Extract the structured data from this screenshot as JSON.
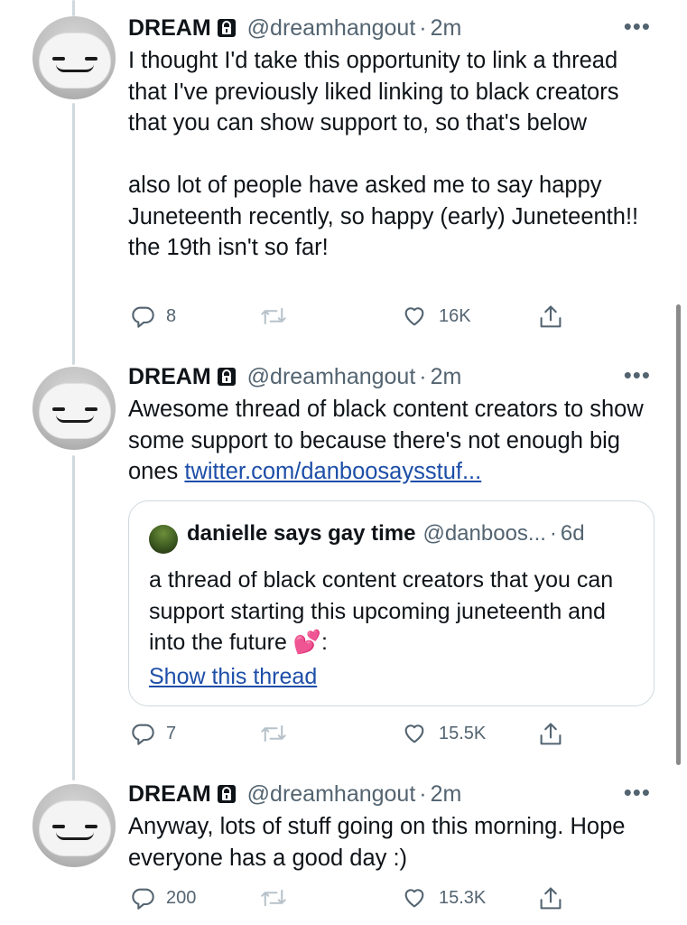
{
  "tweets": [
    {
      "name": "DREAM",
      "handle": "@dreamhangout",
      "dot": "·",
      "time": "2m",
      "more": "•••",
      "text": "I thought I'd take this opportunity to link a thread that I've previously liked linking to black creators that you can show support to, so that's below\n\nalso lot of people have asked me to say happy Juneteenth recently, so happy (early) Juneteenth!! the 19th isn't so far!",
      "replies": "8",
      "retweets": "",
      "likes": "16K"
    },
    {
      "name": "DREAM",
      "handle": "@dreamhangout",
      "dot": "·",
      "time": "2m",
      "more": "•••",
      "text": "Awesome thread of black content creators to show some support to because there's not enough big ones ",
      "link": "twitter.com/danboosaysstuf...",
      "replies": "7",
      "retweets": "",
      "likes": "15.5K",
      "quote": {
        "name": "danielle says gay time",
        "handle": "@danboos...",
        "dot": "·",
        "time": "6d",
        "text": "a thread of black content creators that you can support starting this upcoming juneteenth and into the future ",
        "emoji": "💕",
        "text_end": ":",
        "show_thread": "Show this thread"
      }
    },
    {
      "name": "DREAM",
      "handle": "@dreamhangout",
      "dot": "·",
      "time": "2m",
      "more": "•••",
      "text": "Anyway, lots of stuff going on this morning. Hope everyone has a good day :)",
      "replies": "200",
      "retweets": "",
      "likes": "15.3K"
    }
  ],
  "icons": {
    "reply": "reply-icon",
    "retweet": "retweet-icon",
    "like": "heart-icon",
    "share": "share-icon",
    "lock": "lock-icon"
  },
  "colors": {
    "text": "#0f1419",
    "muted": "#536471",
    "link": "#1d4ea8",
    "thread_line": "#cfd9de"
  }
}
